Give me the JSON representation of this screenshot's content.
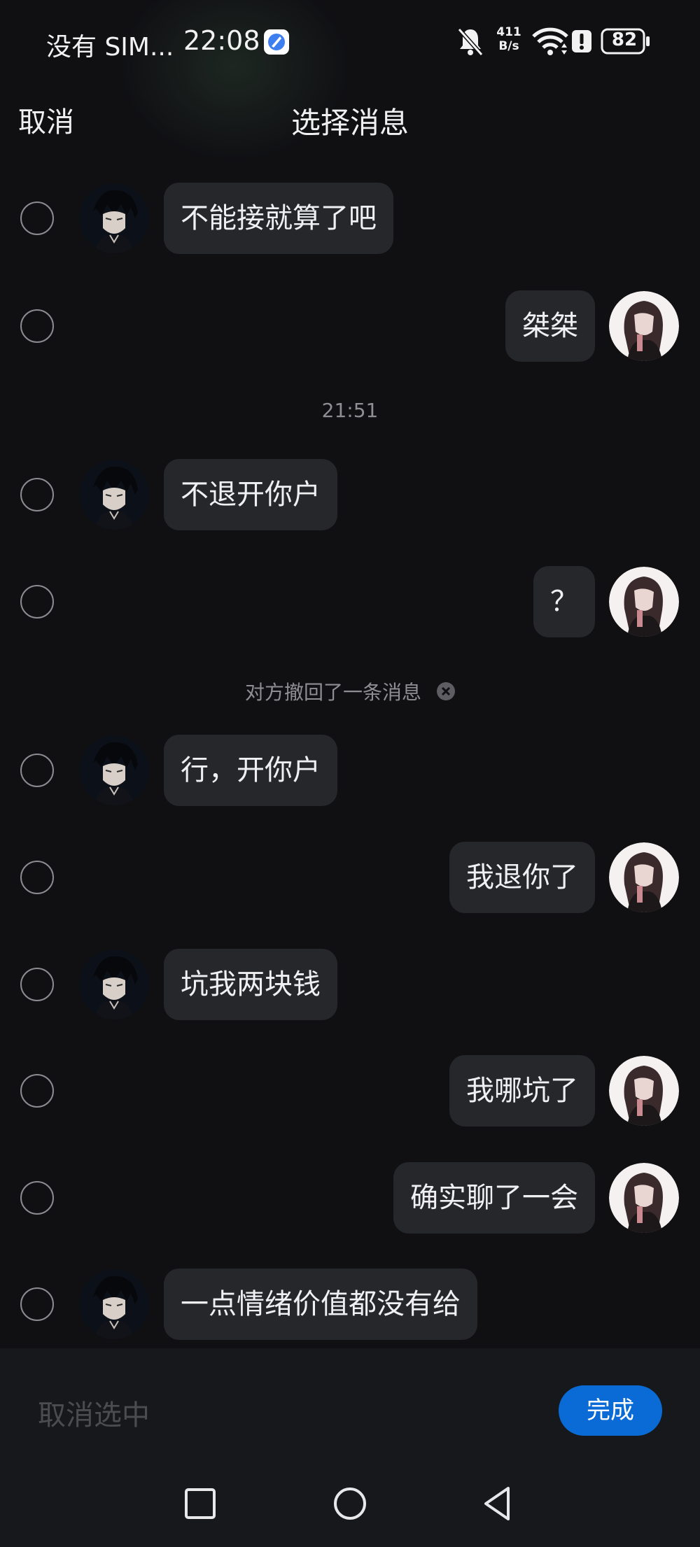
{
  "status_bar": {
    "carrier": "没有 SIM...",
    "time": "22:08",
    "speed_top": "411",
    "speed_bottom": "B/s",
    "battery": "82"
  },
  "header": {
    "cancel_label": "取消",
    "title": "选择消息"
  },
  "messages": [
    {
      "side": "in",
      "text": "不能接就算了吧"
    },
    {
      "side": "out",
      "text": "桀桀"
    },
    {
      "side": "in",
      "text": "不退开你户"
    },
    {
      "side": "out",
      "text": "？"
    },
    {
      "side": "in",
      "text": "行，开你户"
    },
    {
      "side": "out",
      "text": "我退你了"
    },
    {
      "side": "in",
      "text": "坑我两块钱"
    },
    {
      "side": "out",
      "text": "我哪坑了"
    },
    {
      "side": "out",
      "text": "确实聊了一会"
    },
    {
      "side": "in",
      "text": "一点情绪价值都没有给"
    }
  ],
  "timestamp": "21:51",
  "recall_notice": "对方撤回了一条消息",
  "bottom": {
    "deselect_label": "取消选中",
    "done_label": "完成"
  },
  "colors": {
    "background": "#101013",
    "bubble": "#26272b",
    "accent": "#0a6bd6"
  }
}
